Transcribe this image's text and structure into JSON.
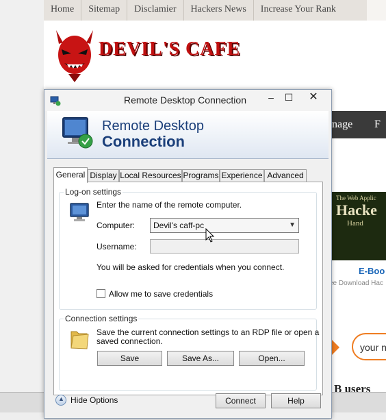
{
  "site": {
    "nav": [
      "Home",
      "Sitemap",
      "Disclamier",
      "Hackers News",
      "Increase Your Rank"
    ],
    "logo_text": "DEVIL'S CAFE",
    "darkbar_items": [
      "nage",
      "F"
    ],
    "book_title_line1": "The Web Applic",
    "book_title_line2": "Hacke",
    "book_title_line3": "Hand",
    "ebook_link": "E-Boo",
    "ebook_sub": "ee Download Hac",
    "search_placeholder": "your n",
    "users_text": "B users"
  },
  "window": {
    "title": "Remote Desktop Connection",
    "min_glyph": "–",
    "max_glyph": "☐",
    "close_glyph": "✕",
    "banner_line1": "Remote Desktop",
    "banner_line2": "Connection",
    "tabs": [
      "General",
      "Display",
      "Local Resources",
      "Programs",
      "Experience",
      "Advanced"
    ],
    "active_tab": "General",
    "logon": {
      "group_title": "Log-on settings",
      "instruction": "Enter the name of the remote computer.",
      "computer_label": "Computer:",
      "computer_value": "Devil's caff-pc",
      "username_label": "Username:",
      "username_value": "",
      "credentials_note": "You will be asked for credentials when you connect.",
      "allow_save_label": "Allow me to save credentials",
      "allow_save_checked": false
    },
    "connection": {
      "group_title": "Connection settings",
      "description_line1": "Save the current connection settings to an RDP file or open a",
      "description_line2": "saved connection.",
      "save_label": "Save",
      "save_as_label": "Save As...",
      "open_label": "Open..."
    },
    "footer": {
      "hide_options_label": "Hide Options",
      "connect_label": "Connect",
      "help_label": "Help"
    }
  },
  "colors": {
    "banner_text": "#1b3f7a",
    "logo_red": "#c01010",
    "accent_orange": "#ef7d22",
    "link_blue": "#1a66b8"
  }
}
